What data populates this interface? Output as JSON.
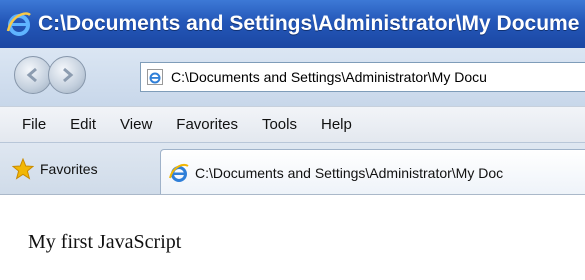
{
  "window": {
    "title": "C:\\Documents and Settings\\Administrator\\My Docume"
  },
  "address_bar": {
    "url": "C:\\Documents and Settings\\Administrator\\My Docu",
    "page_icon": "ie-page-icon"
  },
  "navigation": {
    "back_icon": "back-arrow-icon",
    "forward_icon": "forward-arrow-icon"
  },
  "menu": {
    "items": [
      "File",
      "Edit",
      "View",
      "Favorites",
      "Tools",
      "Help"
    ]
  },
  "favorites_bar": {
    "favorites_label": "Favorites",
    "favorites_icon": "star-icon",
    "tab_title": "C:\\Documents and Settings\\Administrator\\My Doc"
  },
  "page": {
    "body_text": "My first JavaScript"
  },
  "colors": {
    "titlebar": "#2457b8",
    "title_text": "#ffffff",
    "chrome": "#d6e1ef",
    "star": "#f2b705"
  }
}
